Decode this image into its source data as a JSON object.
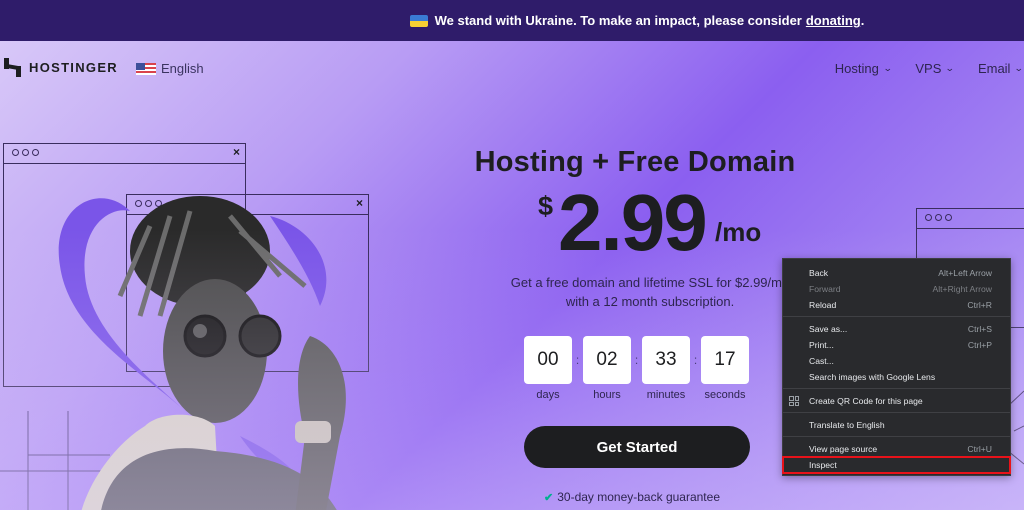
{
  "banner": {
    "flag_icon": "ukraine-flag-icon",
    "text": "We stand with Ukraine. To make an impact, please consider",
    "link": "donating",
    "after": "."
  },
  "nav": {
    "logo_text": "HOSTINGER",
    "language": "English",
    "items": [
      {
        "label": "Hosting",
        "icon": "chevron-down-icon"
      },
      {
        "label": "VPS",
        "icon": "chevron-down-icon"
      },
      {
        "label": "Email",
        "icon": "chevron-down-icon"
      }
    ]
  },
  "hero": {
    "headline": "Hosting + Free Domain",
    "currency": "$",
    "price": "2.99",
    "period": "/mo",
    "subtitle_line1": "Get a free domain and lifetime SSL for $2.99/mo",
    "subtitle_line2": "with a 12 month subscription.",
    "countdown": [
      {
        "value": "00",
        "label": "days"
      },
      {
        "value": "02",
        "label": "hours"
      },
      {
        "value": "33",
        "label": "minutes"
      },
      {
        "value": "17",
        "label": "seconds"
      }
    ],
    "separator": ":",
    "cta": "Get Started",
    "guarantee": "30-day money-back guarantee",
    "window_close": "×"
  },
  "context_menu": {
    "groups": [
      [
        {
          "label": "Back",
          "shortcut": "Alt+Left Arrow",
          "disabled": false
        },
        {
          "label": "Forward",
          "shortcut": "Alt+Right Arrow",
          "disabled": true
        },
        {
          "label": "Reload",
          "shortcut": "Ctrl+R",
          "disabled": false
        }
      ],
      [
        {
          "label": "Save as...",
          "shortcut": "Ctrl+S",
          "disabled": false
        },
        {
          "label": "Print...",
          "shortcut": "Ctrl+P",
          "disabled": false
        },
        {
          "label": "Cast...",
          "shortcut": "",
          "disabled": false
        },
        {
          "label": "Search images with Google Lens",
          "shortcut": "",
          "disabled": false
        }
      ],
      [
        {
          "label": "Create QR Code for this page",
          "shortcut": "",
          "icon": "qr-code-icon",
          "disabled": false
        }
      ],
      [
        {
          "label": "Translate to English",
          "shortcut": "",
          "disabled": false
        }
      ],
      [
        {
          "label": "View page source",
          "shortcut": "Ctrl+U",
          "disabled": false
        },
        {
          "label": "Inspect",
          "shortcut": "",
          "disabled": false,
          "highlighted": true
        }
      ]
    ],
    "highlight_color": "#e8121a"
  },
  "colors": {
    "banner_bg": "#2f1c6a",
    "accent_purple": "#8b5ff0",
    "cta_bg": "#1d1e20",
    "check_green": "#00b090",
    "menu_bg": "#292a2d"
  }
}
